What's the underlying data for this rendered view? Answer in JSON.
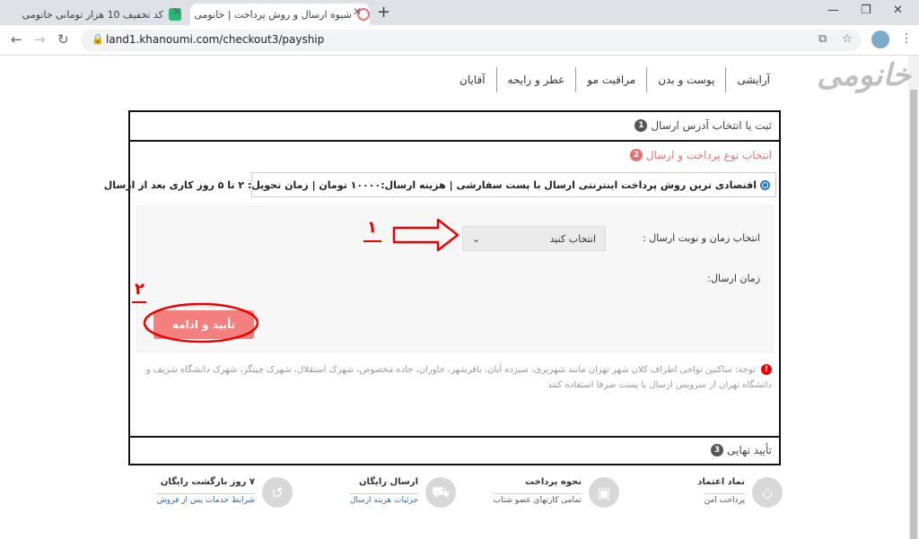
{
  "browser": {
    "tabs": [
      {
        "title": "کد تخفیف 10 هزار تومانی خانومی  ",
        "fav_color": "#2bb673"
      },
      {
        "title": "شیوه ارسال و روش پرداخت | خانومی",
        "fav_color": "#e57373"
      }
    ],
    "url": "land1.khanoumi.com/checkout3/payship",
    "new_tab": "+",
    "close": "✕"
  },
  "site": {
    "logo": "خانومی",
    "nav": [
      "آرایشی",
      "پوست و بدن",
      "مراقبت مو",
      "عطر و رایحه",
      "آقایان"
    ]
  },
  "checkout": {
    "step1": {
      "num": "1",
      "label": "ثبت یا انتخاب آدرس ارسال",
      "color": "#555555"
    },
    "step2": {
      "num": "2",
      "label": "انتخاب نوع پرداخت و ارسال",
      "color": "#e57373"
    },
    "payment_option": "اقتصادی ترین روش پرداخت اینترنتی ارسال با پست سفارشی | هزینه ارسال:۱۰۰۰۰ تومان | زمان تحویل: ۲ تا ۵ روز کاری بعد از ارسال",
    "time_label": "انتخاب زمان و نوبت ارسال :",
    "select_value": "انتخاب کنید",
    "send_time_label": "زمان ارسال:",
    "submit_label": "تأیید و ادامه",
    "note": "توجه: ساکنین نواحی اطراف کلان شهر تهران مانند شهریری، سیزده آبان، باقرشهر، خاوران، جاده مخصوص، شهرک استقلال، شهرک چیتگر، شهرک دانشگاه شریف و دانشگاه تهران از سرویس ارسال با پست صرفا استفاده کنند",
    "step3": {
      "num": "3",
      "label": "تأیید نهایی",
      "color": "#555555"
    }
  },
  "annotations": {
    "first": "۱",
    "second": "۲",
    "color": "#e00000"
  },
  "features": [
    {
      "title": "نماد اعتماد",
      "sub": "پرداخت امن",
      "icon": "diamond-icon",
      "link": false
    },
    {
      "title": "نحوه پرداخت",
      "sub": "تمامی کارتهای عضو شتاب",
      "icon": "wallet-icon",
      "link": false
    },
    {
      "title": "ارسال رایگان",
      "sub": "جزئیات هزینه ارسال",
      "icon": "truck-icon",
      "link": true
    },
    {
      "title": "۷ روز بازگشت رایگان",
      "sub": "شرایط خدمات پس از فروش",
      "icon": "return-icon",
      "link": true
    }
  ]
}
